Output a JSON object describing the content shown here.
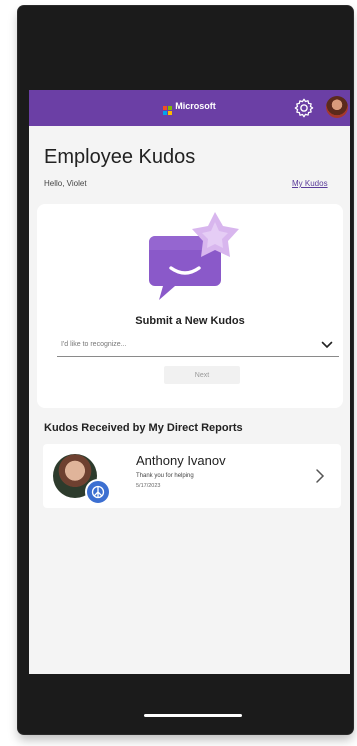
{
  "header": {
    "brand_name": "Microsoft",
    "brand_colors": [
      "#f25022",
      "#7fba00",
      "#00a4ef",
      "#ffb900"
    ],
    "accent_color": "#6b3fa5",
    "settings_icon": "gear-icon",
    "profile_avatar": "avatar"
  },
  "page": {
    "title": "Employee Kudos",
    "greeting": "Hello, Violet",
    "my_kudos_link": "My Kudos"
  },
  "submit_card": {
    "illustration": "chat-bubble-star-icon",
    "title": "Submit a New Kudos",
    "select_placeholder": "I'd like to recognize...",
    "select_icon": "chevron-down-icon",
    "next_label": "Next"
  },
  "direct_reports": {
    "section_title": "Kudos Received by My Direct Reports",
    "items": [
      {
        "name": "Anthony Ivanov",
        "message": "Thank you for helping",
        "date": "5/17/2023",
        "badge_icon": "peace-icon",
        "chevron": "chevron-right-icon"
      }
    ]
  }
}
